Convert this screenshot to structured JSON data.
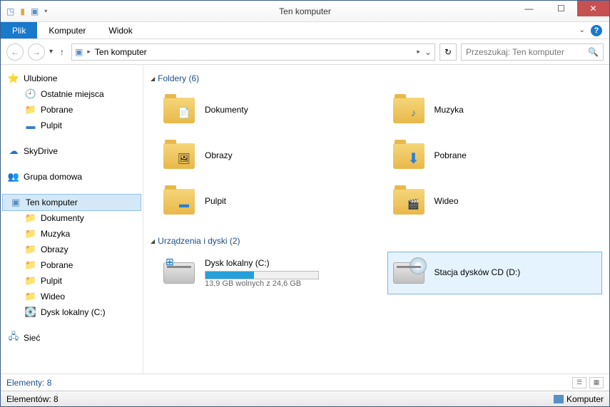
{
  "window": {
    "title": "Ten komputer"
  },
  "ribbon": {
    "file": "Plik",
    "tabs": [
      "Komputer",
      "Widok"
    ]
  },
  "nav": {
    "breadcrumb": "Ten komputer",
    "search_placeholder": "Przeszukaj: Ten komputer"
  },
  "sidebar": {
    "favorites": {
      "label": "Ulubione",
      "items": [
        "Ostatnie miejsca",
        "Pobrane",
        "Pulpit"
      ]
    },
    "skydrive": {
      "label": "SkyDrive"
    },
    "homegroup": {
      "label": "Grupa domowa"
    },
    "thispc": {
      "label": "Ten komputer",
      "items": [
        "Dokumenty",
        "Muzyka",
        "Obrazy",
        "Pobrane",
        "Pulpit",
        "Wideo",
        "Dysk lokalny (C:)"
      ]
    },
    "network": {
      "label": "Sieć"
    }
  },
  "sections": {
    "folders": {
      "label": "Foldery (6)",
      "items": [
        {
          "name": "Dokumenty",
          "icon": "📄"
        },
        {
          "name": "Muzyka",
          "icon": "🎵"
        },
        {
          "name": "Obrazy",
          "icon": "🖼"
        },
        {
          "name": "Pobrane",
          "icon": "⬇"
        },
        {
          "name": "Pulpit",
          "icon": "🖥"
        },
        {
          "name": "Wideo",
          "icon": "🎬"
        }
      ]
    },
    "drives": {
      "label": "Urządzenia i dyski (2)",
      "local": {
        "name": "Dysk lokalny (C:)",
        "free_text": "13,9 GB wolnych z 24,6 GB",
        "used_pct": 43
      },
      "cd": {
        "name": "Stacja dysków CD (D:)"
      }
    }
  },
  "status": {
    "items": "Elementy: 8",
    "elements": "Elementów: 8",
    "location": "Komputer"
  }
}
